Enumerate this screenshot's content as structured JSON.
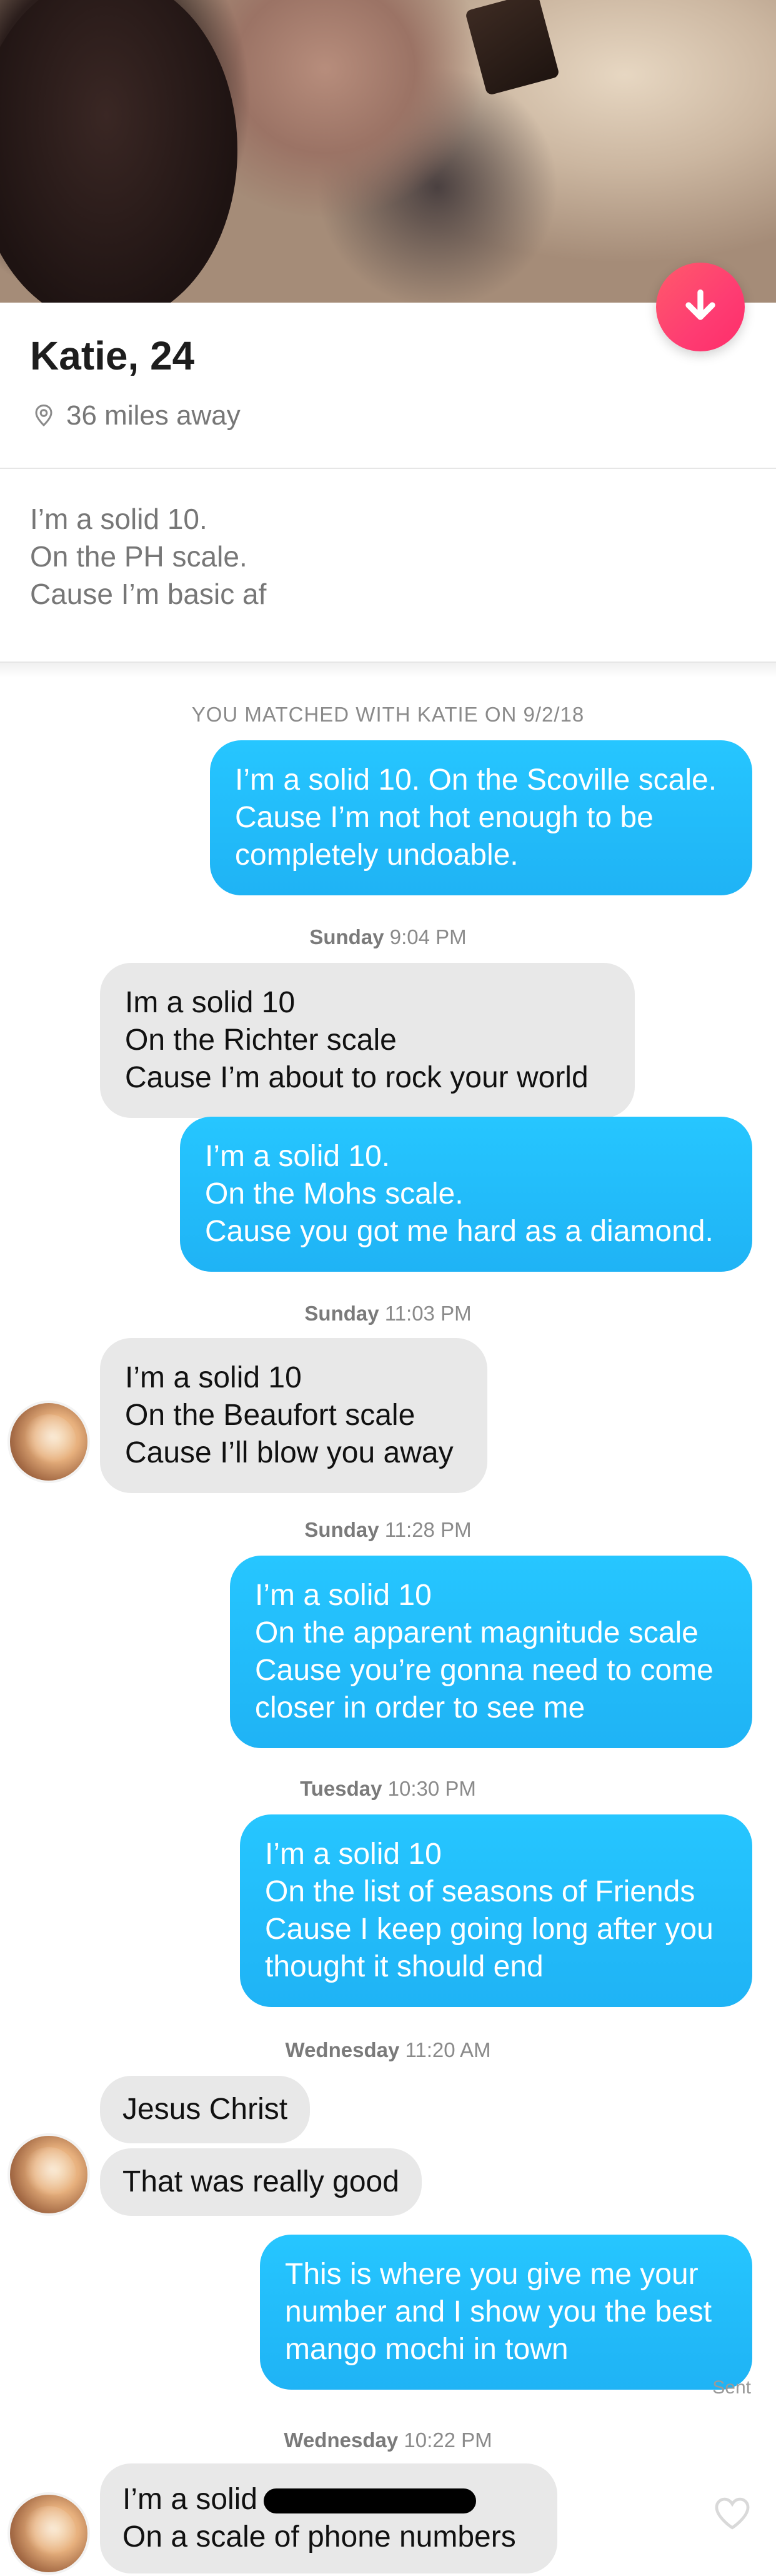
{
  "profile": {
    "name_age": "Katie, 24",
    "distance": "36 miles away",
    "bio": [
      "I’m a solid 10.",
      "On the PH scale.",
      "Cause I’m basic af"
    ]
  },
  "match_banner": "YOU MATCHED WITH KATIE ON 9/2/18",
  "messages": {
    "m1": [
      "I’m a solid 10. On the Scoville scale.",
      "Cause I’m not hot enough to be",
      "completely undoable."
    ],
    "ts1": {
      "day": "Sunday",
      "time": "9:04 PM"
    },
    "m2": [
      "Im a solid 10",
      "On the Richter scale",
      "Cause I’m about to rock your world"
    ],
    "m3": [
      "I’m a solid 10.",
      "On the Mohs scale.",
      "Cause you got me hard as a diamond."
    ],
    "ts2": {
      "day": "Sunday",
      "time": "11:03 PM"
    },
    "m4": [
      "I’m a solid 10",
      "On the Beaufort scale",
      "Cause I’ll blow you away"
    ],
    "ts3": {
      "day": "Sunday",
      "time": "11:28 PM"
    },
    "m5": [
      "I’m a solid 10",
      "On the apparent magnitude scale",
      "Cause you’re gonna need to come",
      "closer in order to see me"
    ],
    "ts4": {
      "day": "Tuesday",
      "time": "10:30 PM"
    },
    "m6": [
      "I’m a solid 10",
      "On the list of seasons of Friends",
      "Cause I keep going long after you",
      "thought it should end"
    ],
    "ts5": {
      "day": "Wednesday",
      "time": "11:20 AM"
    },
    "m7": "Jesus Christ",
    "m8": "That was really good",
    "m9": [
      "This is where you give me your",
      "number and I show you the best",
      "mango mochi in town"
    ],
    "sent_label": "Sent",
    "ts6": {
      "day": "Wednesday",
      "time": "10:22 PM"
    },
    "m10_line1": "I’m a solid",
    "m10_line2": "On a scale of phone numbers"
  },
  "icons": {
    "fab": "arrow-down-icon",
    "location": "location-pin-icon",
    "like": "heart-icon",
    "avatar": "avatar-photo"
  },
  "colors": {
    "sent_bubble": "#1fb3f5",
    "received_bubble": "#e8e8e8",
    "fab": "#fe3c72"
  }
}
